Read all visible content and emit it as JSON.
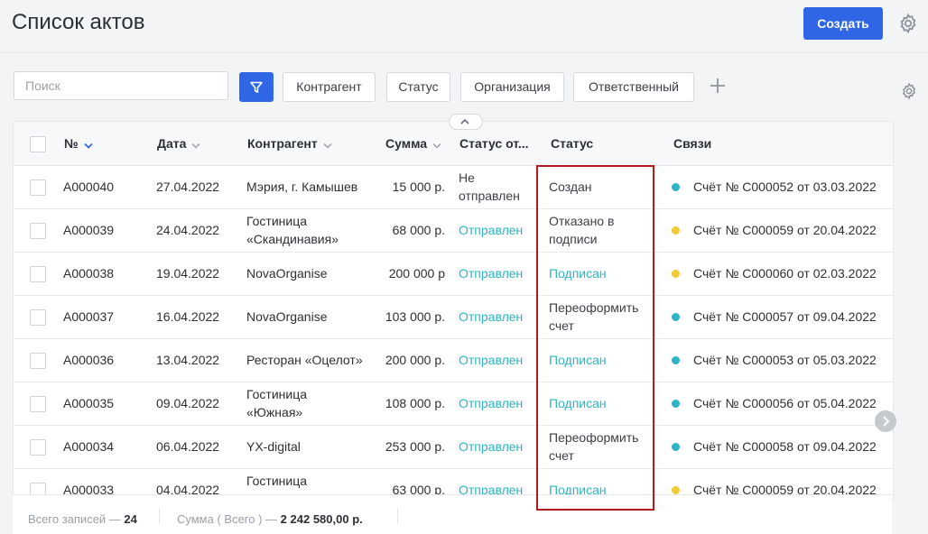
{
  "header": {
    "title": "Список актов",
    "create_label": "Создать"
  },
  "filters": {
    "search_placeholder": "Поиск",
    "chips": [
      "Контрагент",
      "Статус",
      "Организация",
      "Ответственный"
    ]
  },
  "table": {
    "columns": {
      "number": "№",
      "date": "Дата",
      "counterparty": "Контрагент",
      "amount": "Сумма",
      "send_status": "Статус от...",
      "status": "Статус",
      "links": "Связи"
    },
    "rows": [
      {
        "number": "A000040",
        "date": "27.04.2022",
        "counterparty": [
          "Мэрия, г. Камышев"
        ],
        "amount": "15 000 р.",
        "send_status": [
          "Не",
          "отправлен"
        ],
        "send_kind": "gray",
        "status": [
          "Создан"
        ],
        "status_kind": "gray",
        "link": "Счёт № C000052 от 03.03.2022",
        "dot": "#2bb5c4"
      },
      {
        "number": "A000039",
        "date": "24.04.2022",
        "counterparty": [
          "Гостиница",
          "«Скандинавия»"
        ],
        "amount": "68 000 р.",
        "send_status": [
          "Отправлен"
        ],
        "send_kind": "sent",
        "status": [
          "Отказано в",
          "подписи"
        ],
        "status_kind": "gray",
        "link": "Счёт № C000059 от 20.04.2022",
        "dot": "#f0c934"
      },
      {
        "number": "A000038",
        "date": "19.04.2022",
        "counterparty": [
          "NovaOrganise"
        ],
        "amount": "200 000 р",
        "send_status": [
          "Отправлен"
        ],
        "send_kind": "sent",
        "status": [
          "Подписан"
        ],
        "status_kind": "signed",
        "link": "Счёт № C000060 от 02.03.2022",
        "dot": "#f0c934"
      },
      {
        "number": "A000037",
        "date": "16.04.2022",
        "counterparty": [
          "NovaOrganise"
        ],
        "amount": "103 000 р.",
        "send_status": [
          "Отправлен"
        ],
        "send_kind": "sent",
        "status": [
          "Переоформить",
          "счет"
        ],
        "status_kind": "gray",
        "link": "Счёт № C000057 от 09.04.2022",
        "dot": "#2bb5c4"
      },
      {
        "number": "A000036",
        "date": "13.04.2022",
        "counterparty": [
          "Ресторан «Оцелот»"
        ],
        "amount": "200 000 р.",
        "send_status": [
          "Отправлен"
        ],
        "send_kind": "sent",
        "status": [
          "Подписан"
        ],
        "status_kind": "signed",
        "link": "Счёт № C000053 от 05.03.2022",
        "dot": "#2bb5c4"
      },
      {
        "number": "A000035",
        "date": "09.04.2022",
        "counterparty": [
          "Гостиница",
          "«Южная»"
        ],
        "amount": "108 000 р.",
        "send_status": [
          "Отправлен"
        ],
        "send_kind": "sent",
        "status": [
          "Подписан"
        ],
        "status_kind": "signed",
        "link": "Счёт № C000056 от 05.04.2022",
        "dot": "#2bb5c4"
      },
      {
        "number": "A000034",
        "date": "06.04.2022",
        "counterparty": [
          "YX-digital"
        ],
        "amount": "253 000 р.",
        "send_status": [
          "Отправлен"
        ],
        "send_kind": "sent",
        "status": [
          "Переоформить",
          "счет"
        ],
        "status_kind": "gray",
        "link": "Счёт № C000058 от 09.04.2022",
        "dot": "#2bb5c4"
      },
      {
        "number": "A000033",
        "date": "04.04.2022",
        "counterparty": [
          "Гостиница",
          ""
        ],
        "amount": "63 000 р.",
        "send_status": [
          "Отправлен"
        ],
        "send_kind": "sent",
        "status": [
          "Подписан"
        ],
        "status_kind": "signed",
        "link": "Счёт № C000059 от 20.04.2022",
        "dot": "#f0c934"
      }
    ]
  },
  "footer": {
    "total_label": "Всего записей —",
    "total_value": "24",
    "sum_label": "Сумма ( Всего ) —",
    "sum_value": "2 242 580,00 р."
  },
  "colors": {
    "accent": "#2f66e6",
    "teal": "#2bb5c4",
    "yellow": "#f0c934",
    "highlight": "#b3191d"
  }
}
